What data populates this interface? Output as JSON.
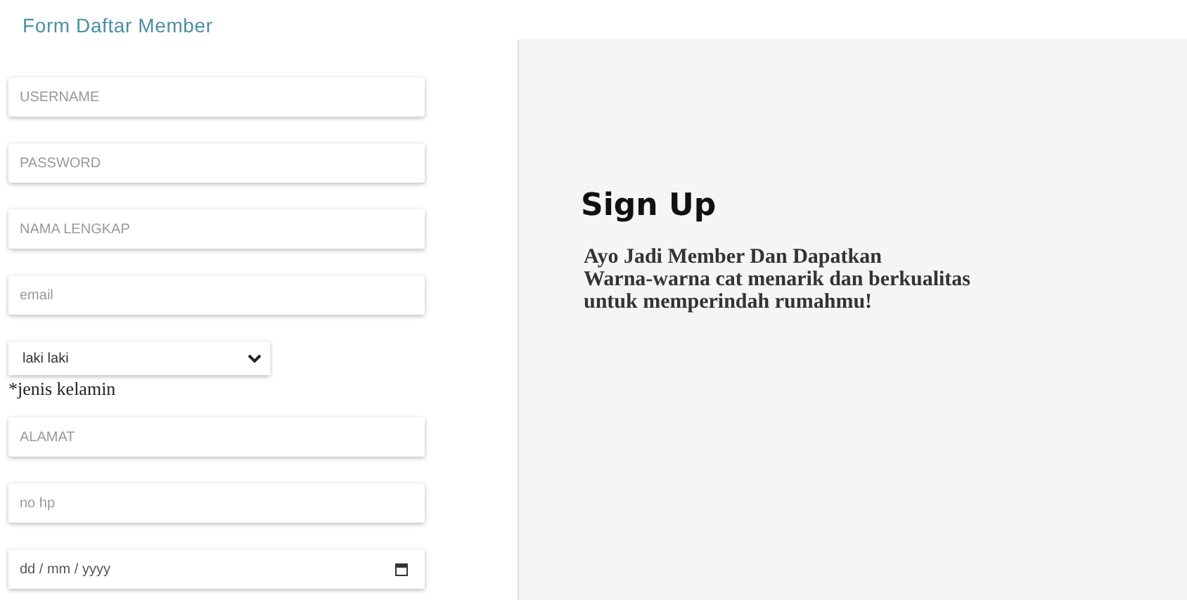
{
  "form": {
    "title": "Form Daftar Member",
    "fields": [
      {
        "kind": "text",
        "placeholder": "USERNAME"
      },
      {
        "kind": "text",
        "placeholder": "PASSWORD"
      },
      {
        "kind": "text",
        "placeholder": "NAMA LENGKAP"
      },
      {
        "kind": "text",
        "placeholder": "email"
      },
      {
        "kind": "select",
        "value": "laki laki",
        "note": "*jenis kelamin"
      },
      {
        "kind": "text",
        "placeholder": "ALAMAT"
      },
      {
        "kind": "text",
        "placeholder": "no hp"
      },
      {
        "kind": "date",
        "placeholder": "dd / mm / yyyy"
      }
    ]
  },
  "panel": {
    "heading": "Sign Up",
    "text": "Ayo Jadi Member Dan Dapatkan\nWarna-warna cat menarik dan berkualitas\nuntuk memperindah rumahmu!"
  }
}
